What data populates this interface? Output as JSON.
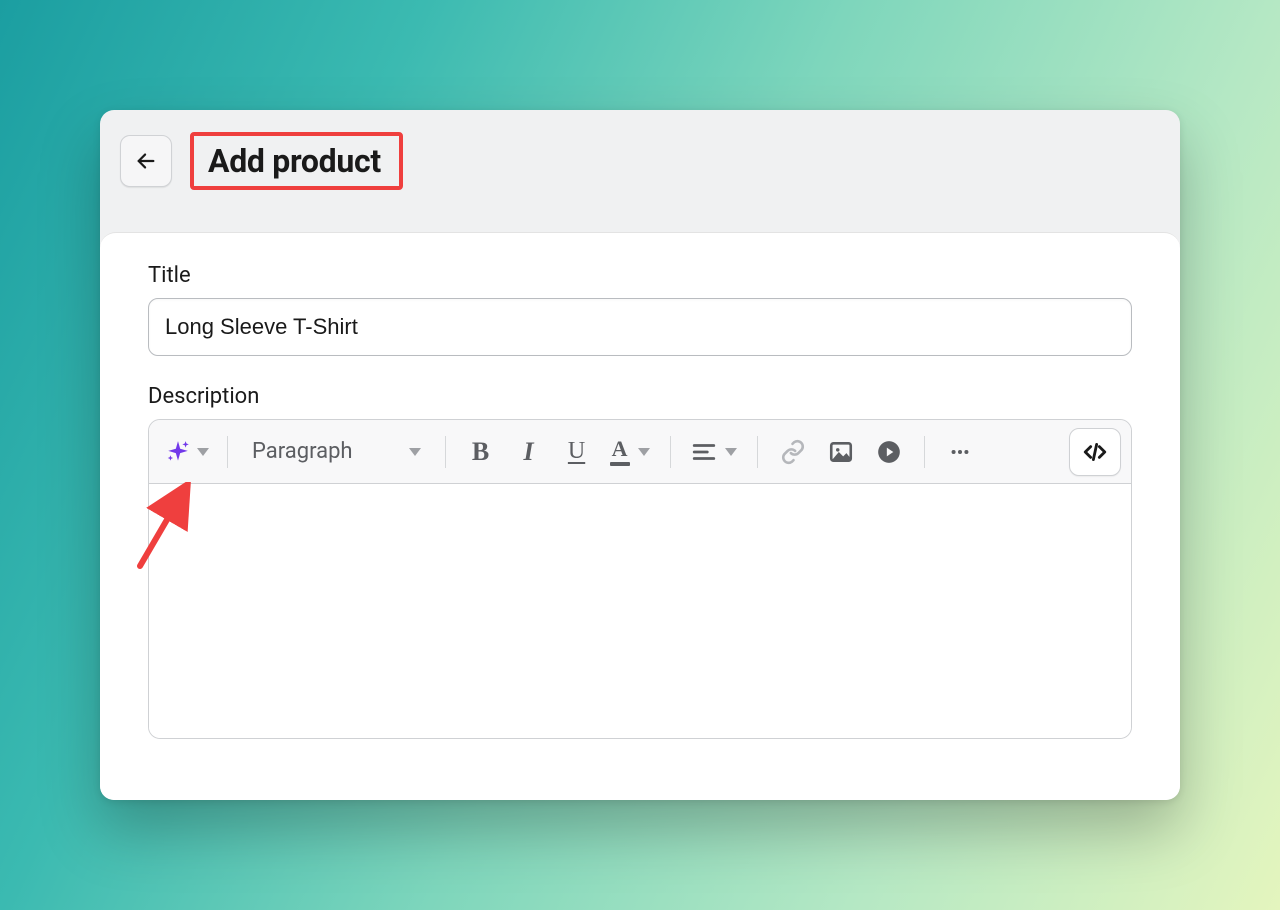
{
  "header": {
    "page_title": "Add product"
  },
  "form": {
    "title_label": "Title",
    "title_value": "Long Sleeve T-Shirt",
    "description_label": "Description",
    "description_value": ""
  },
  "editor": {
    "format_select_value": "Paragraph"
  },
  "colors": {
    "annotation": "#ef3f3e",
    "ai_sparkle": "#7239ea"
  }
}
